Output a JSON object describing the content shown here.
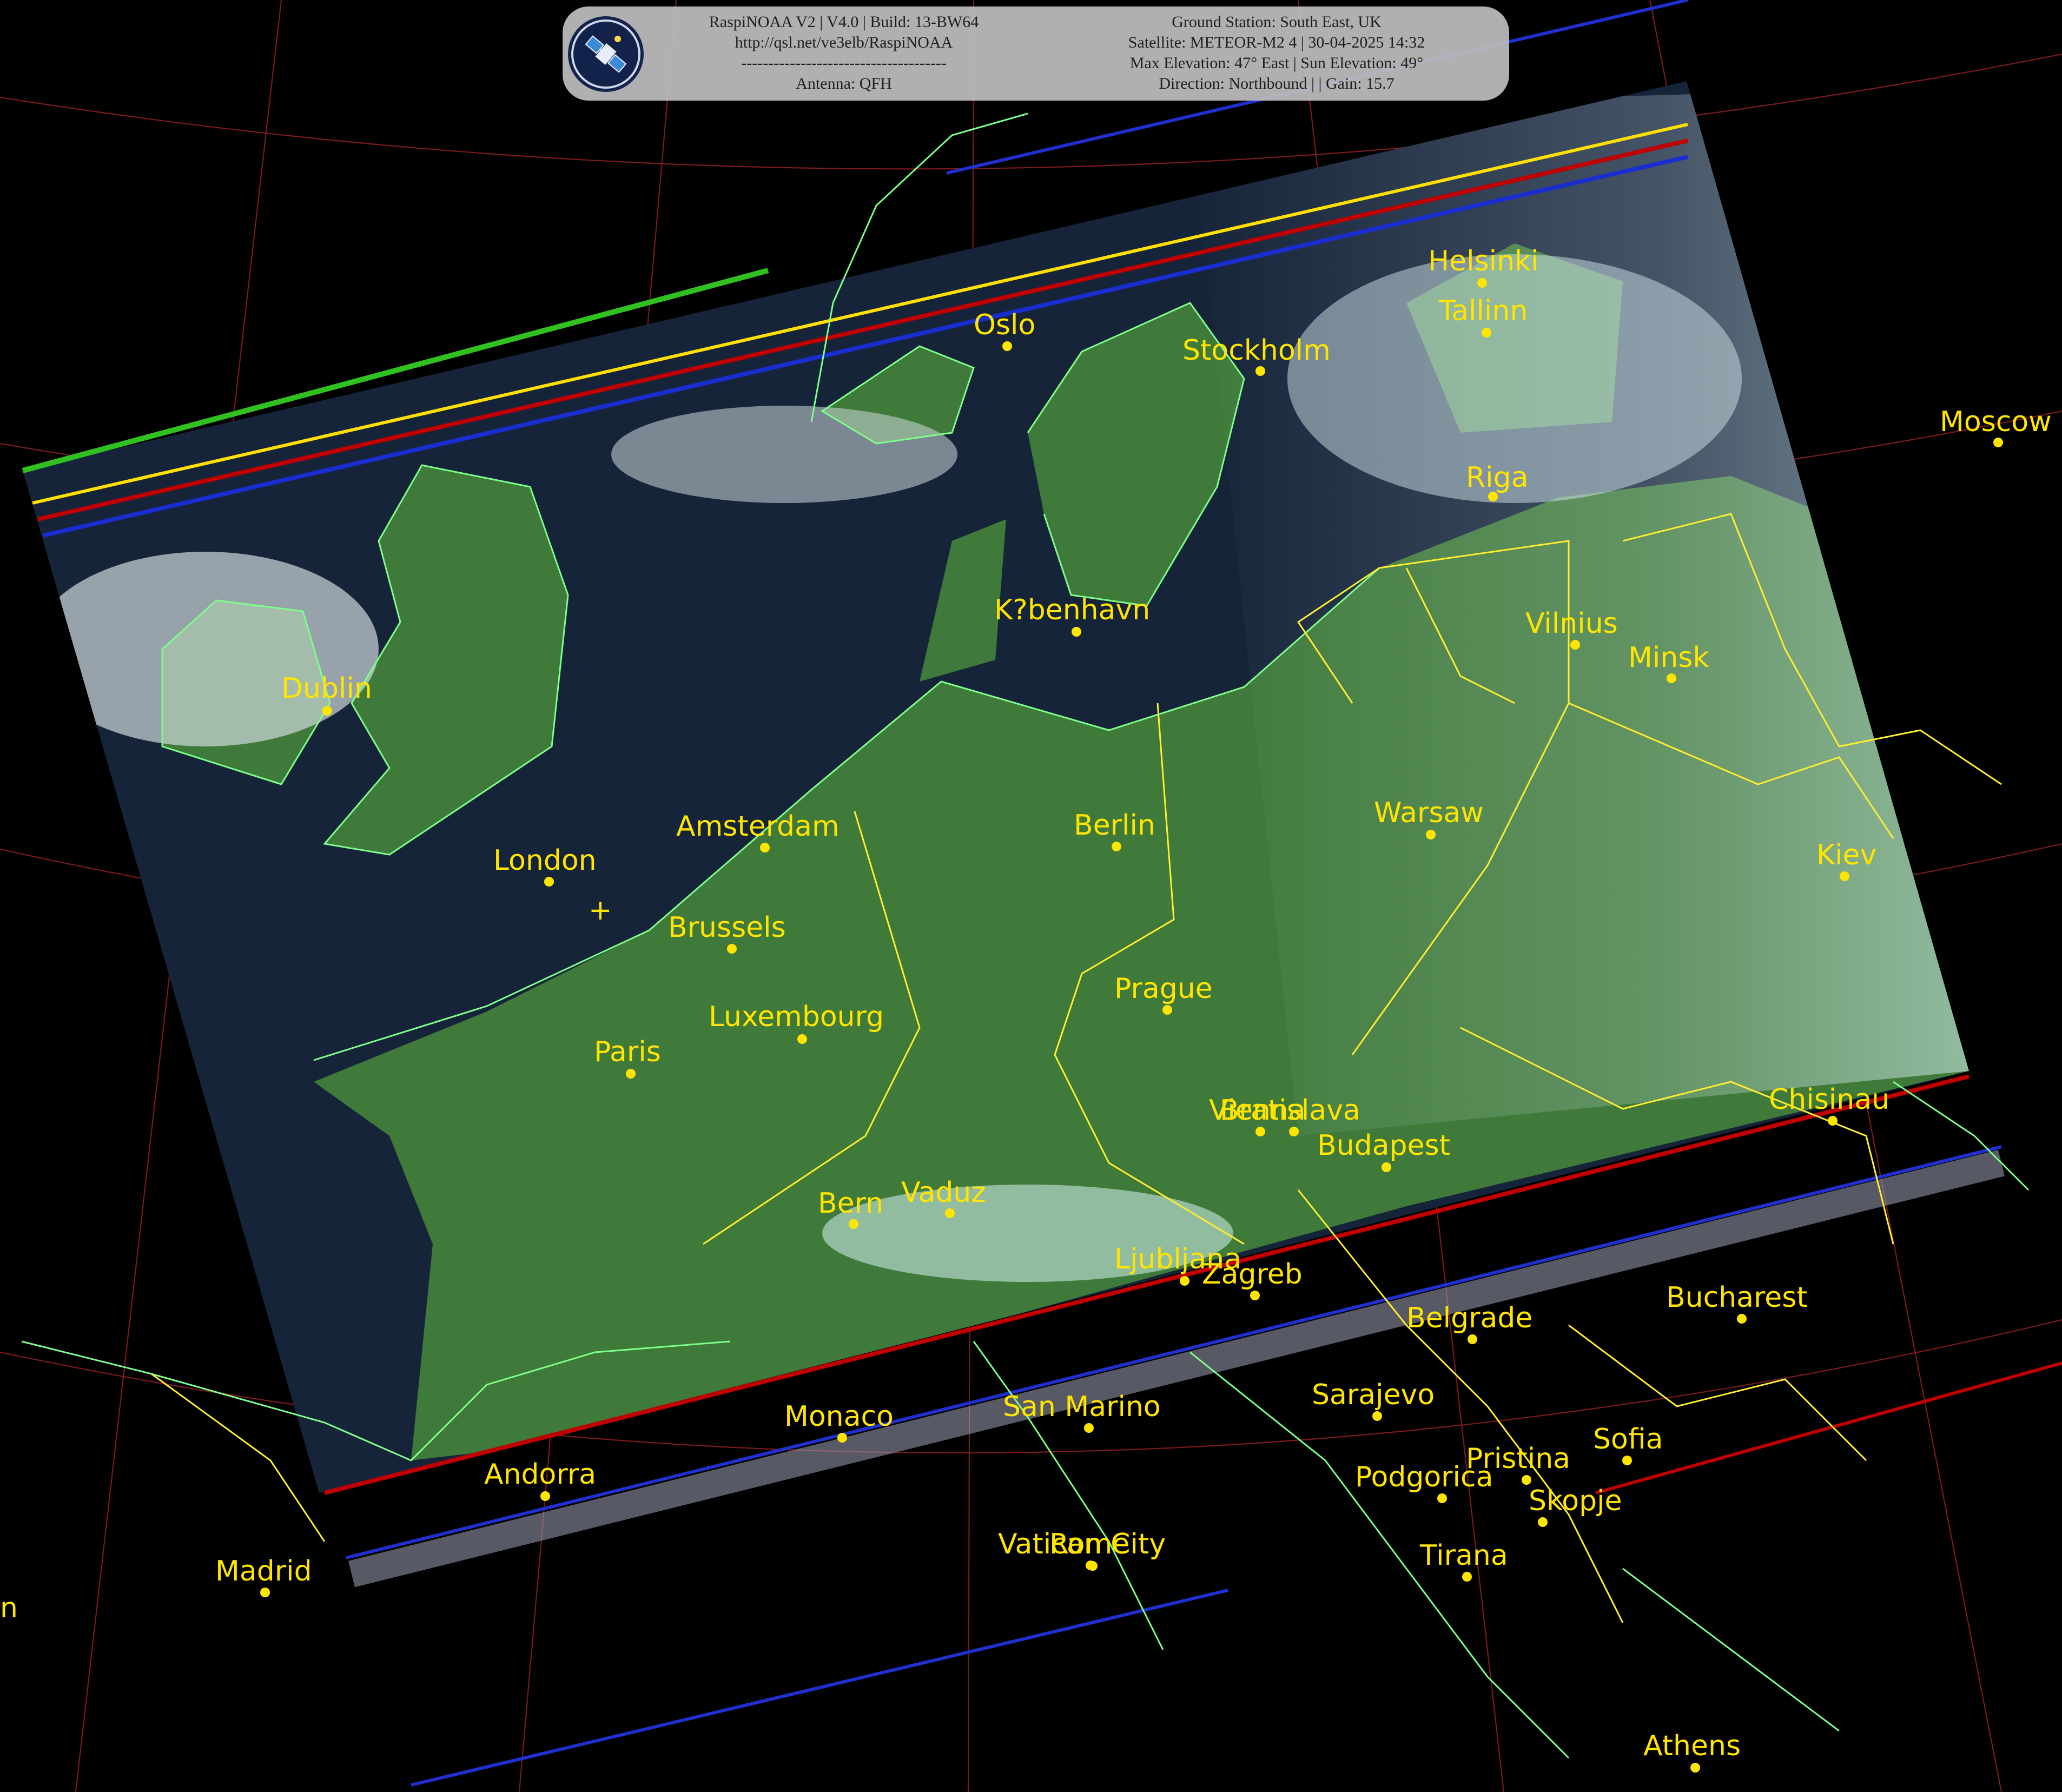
{
  "header": {
    "left_lines": [
      "RaspiNOAA V2 | V4.0 | Build: 13-BW64",
      "http://qsl.net/ve3elb/RaspiNOAA",
      "--------------------------------------",
      "Antenna: QFH"
    ],
    "right_lines": [
      "Ground Station: South East, UK",
      "Satellite: METEOR-M2 4 | 30-04-2025 14:32",
      "Max Elevation: 47° East | Sun Elevation: 49°",
      "Direction: Northbound | | Gain: 15.7"
    ],
    "logo_icon": "satellite-icon"
  },
  "cities": [
    {
      "name": "Helsinki"
    },
    {
      "name": "Tallinn"
    },
    {
      "name": "Oslo"
    },
    {
      "name": "Stockholm"
    },
    {
      "name": "Moscow"
    },
    {
      "name": "Riga"
    },
    {
      "name": "Vilnius"
    },
    {
      "name": "Minsk"
    },
    {
      "name": "K?benhavn"
    },
    {
      "name": "Dublin"
    },
    {
      "name": "Amsterdam"
    },
    {
      "name": "Berlin"
    },
    {
      "name": "Warsaw"
    },
    {
      "name": "Kiev"
    },
    {
      "name": "London"
    },
    {
      "name": "Brussels"
    },
    {
      "name": "Prague"
    },
    {
      "name": "Luxembourg"
    },
    {
      "name": "Paris"
    },
    {
      "name": "Chisinau"
    },
    {
      "name": "Vienna"
    },
    {
      "name": "Bratislava"
    },
    {
      "name": "Budapest"
    },
    {
      "name": "Bern"
    },
    {
      "name": "Vaduz"
    },
    {
      "name": "Ljubljana"
    },
    {
      "name": "Zagreb"
    },
    {
      "name": "Bucharest"
    },
    {
      "name": "Belgrade"
    },
    {
      "name": "Sarajevo"
    },
    {
      "name": "Monaco"
    },
    {
      "name": "San Marino"
    },
    {
      "name": "Sofia"
    },
    {
      "name": "Pristina"
    },
    {
      "name": "Andorra"
    },
    {
      "name": "Podgorica"
    },
    {
      "name": "Skopje"
    },
    {
      "name": "Madrid"
    },
    {
      "name": "Vatican City"
    },
    {
      "name": "Rome"
    },
    {
      "name": "Tirana"
    },
    {
      "name": "Athens"
    },
    {
      "name": "n"
    }
  ],
  "colors": {
    "label": "#ffe500",
    "coastline": "#7dff8a",
    "border": "#ffee30",
    "graticule": "#8a1e1e",
    "land": "#3f7a3a",
    "sea": "#16243a"
  }
}
